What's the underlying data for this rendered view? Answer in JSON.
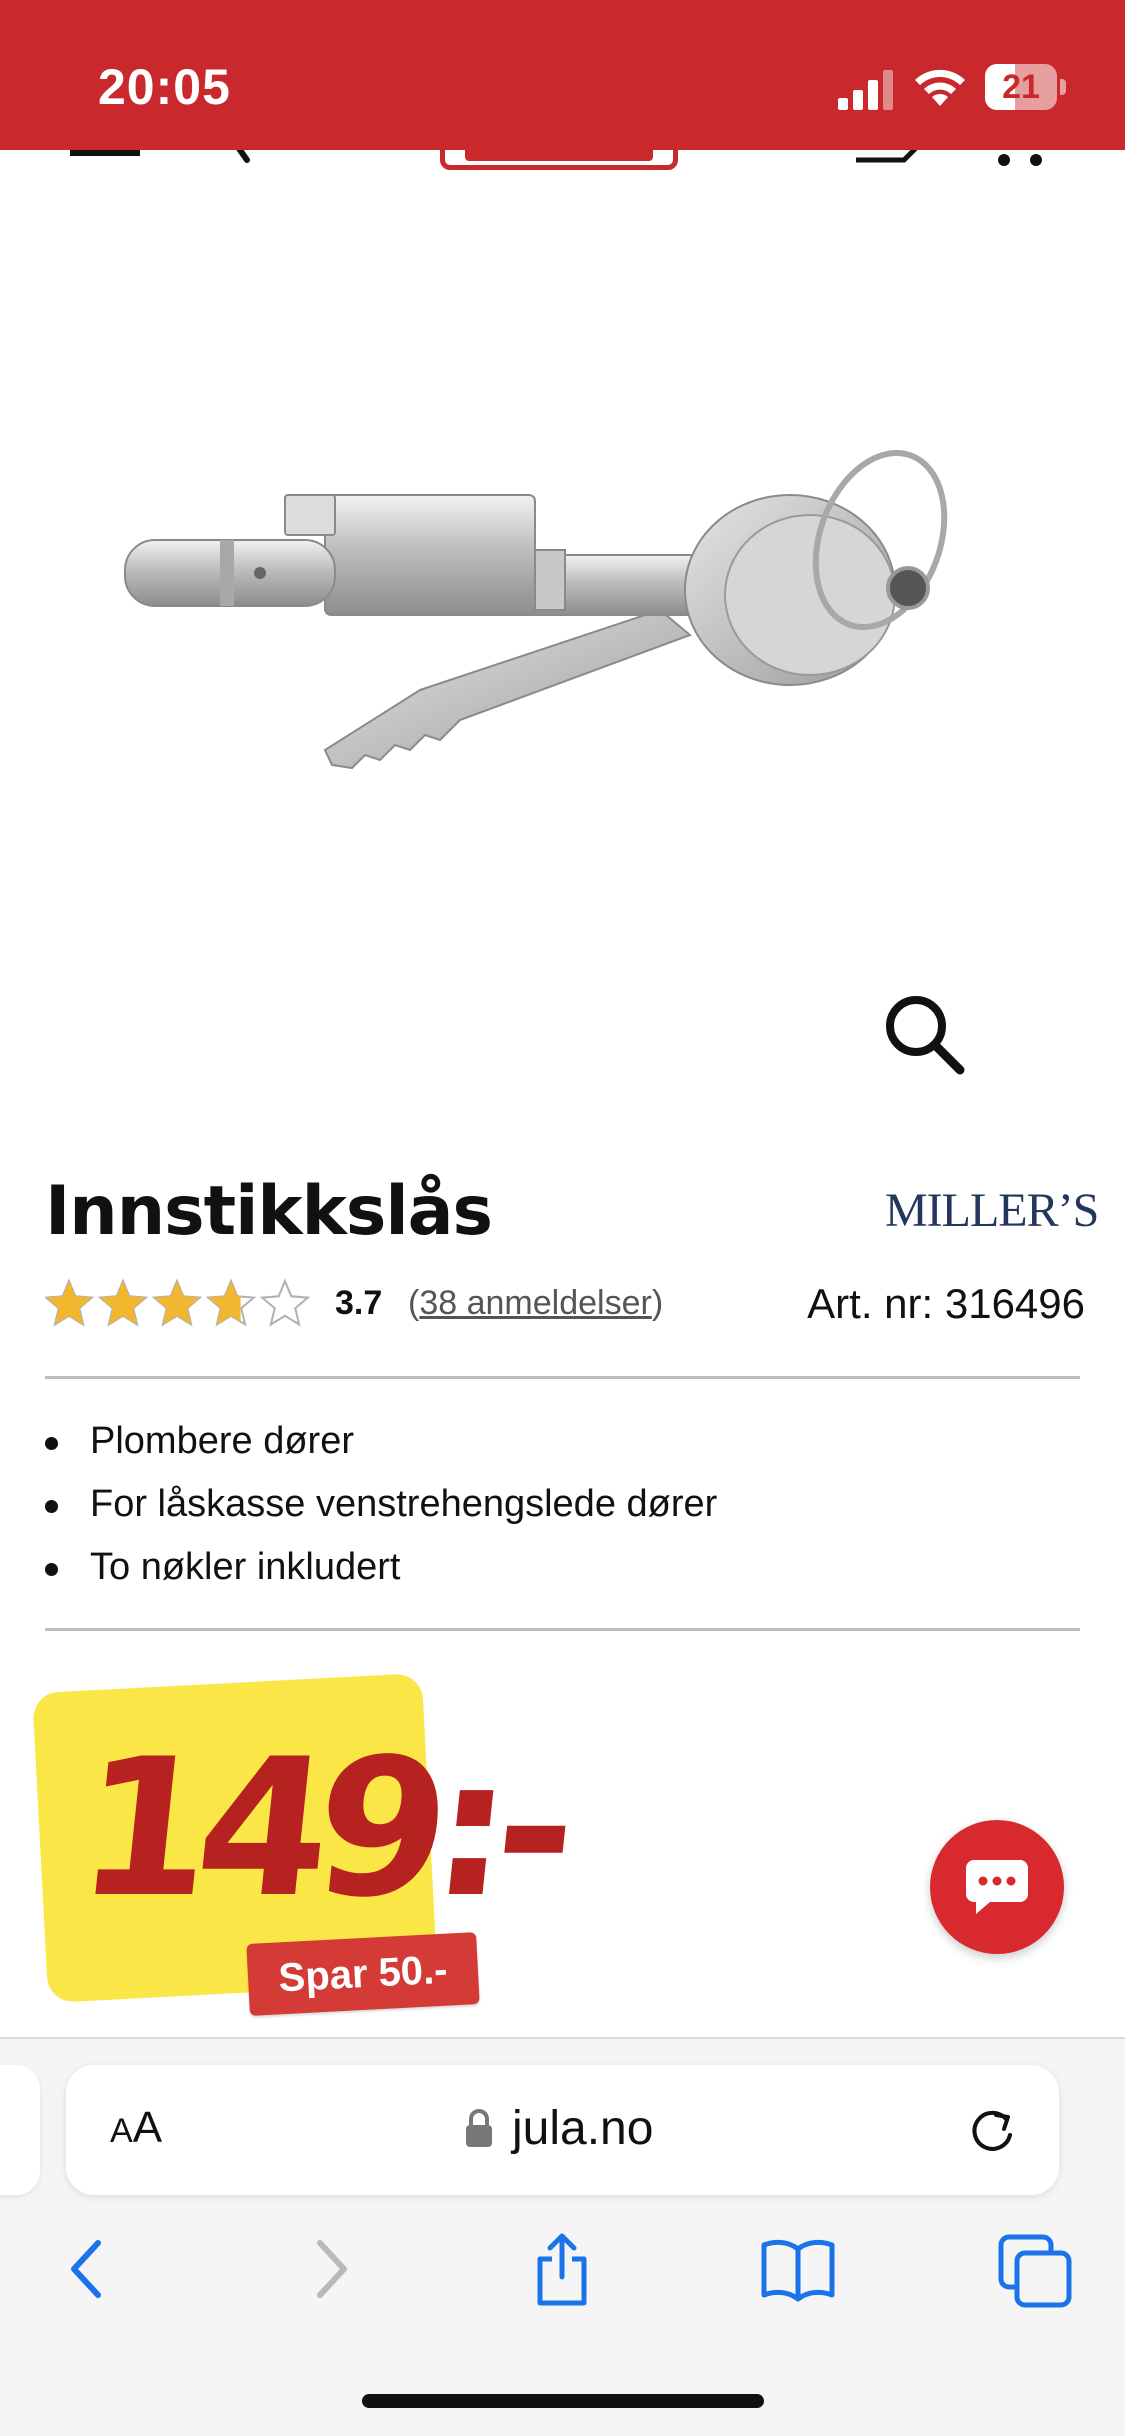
{
  "status_bar": {
    "time": "20:05",
    "battery": "21",
    "background_color": "#c9282c"
  },
  "site_header": {
    "icons": [
      "menu-icon",
      "back-chevron-icon",
      "jula-logo",
      "shopping-list-icon",
      "cart-icon"
    ]
  },
  "product": {
    "title": "Innstikkslås",
    "brand": "MILLER’S",
    "rating": {
      "stars_filled": 3.7,
      "stars_total": 5,
      "value": "3.7",
      "reviews_open": "(",
      "reviews_label": "38 anmeldelser",
      "reviews_close": ")"
    },
    "article_number": "Art. nr: 316496",
    "features": [
      "Plombere dører",
      "For låskasse venstrehengslede dører",
      "To nøkler inkludert"
    ],
    "price": "149:-",
    "savings": "Spar 50.-"
  },
  "browser": {
    "aa_label_small": "A",
    "aa_label_large": "A",
    "url": "jula.no",
    "toolbar_icons": [
      "back-icon",
      "forward-icon",
      "share-icon",
      "bookmarks-icon",
      "tabs-icon"
    ]
  },
  "colors": {
    "brand_red": "#c9282c",
    "price_yellow": "#fbe648",
    "price_red": "#b5221f",
    "star_gold": "#f2b72f",
    "ios_blue": "#1a73e8"
  }
}
